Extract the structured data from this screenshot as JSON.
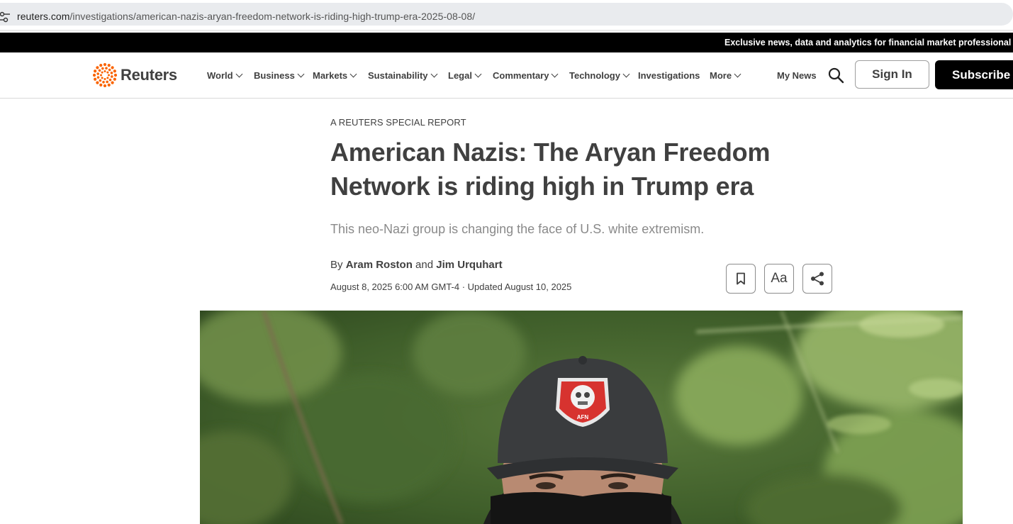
{
  "browser": {
    "url_host": "reuters.com",
    "url_path": "/investigations/american-nazis-aryan-freedom-network-is-riding-high-trump-era-2025-08-08/"
  },
  "banner": {
    "text": "Exclusive news, data and analytics for financial market professional"
  },
  "header": {
    "logo_text": "Reuters",
    "nav": [
      {
        "label": "World",
        "dropdown": true
      },
      {
        "label": "Business",
        "dropdown": true
      },
      {
        "label": "Markets",
        "dropdown": true
      },
      {
        "label": "Sustainability",
        "dropdown": true
      },
      {
        "label": "Legal",
        "dropdown": true
      },
      {
        "label": "Commentary",
        "dropdown": true
      },
      {
        "label": "Technology",
        "dropdown": true
      },
      {
        "label": "Investigations",
        "dropdown": false
      },
      {
        "label": "More",
        "dropdown": true
      }
    ],
    "my_news": "My News",
    "search_icon": "search-icon",
    "sign_in": "Sign In",
    "subscribe": "Subscribe -"
  },
  "article": {
    "kicker": "A REUTERS SPECIAL REPORT",
    "headline": "American Nazis: The Aryan Freedom Network is riding high in Trump era",
    "dek": "This neo-Nazi group is changing the face of U.S. white extremism.",
    "byline": {
      "prefix": "By",
      "author1": "Aram Roston",
      "joiner": "and",
      "author2": "Jim Urquhart"
    },
    "dateline": "August 8, 2025 6:00 AM GMT-4 · Updated August 10, 2025",
    "tools": {
      "bookmark_icon": "bookmark-icon",
      "font_size_label": "Aa",
      "share_icon": "share-icon"
    },
    "hero_cap_badge_text": "AFN"
  },
  "colors": {
    "text": "#404040",
    "accent": "#fa6400",
    "banner_bg": "#000000"
  }
}
